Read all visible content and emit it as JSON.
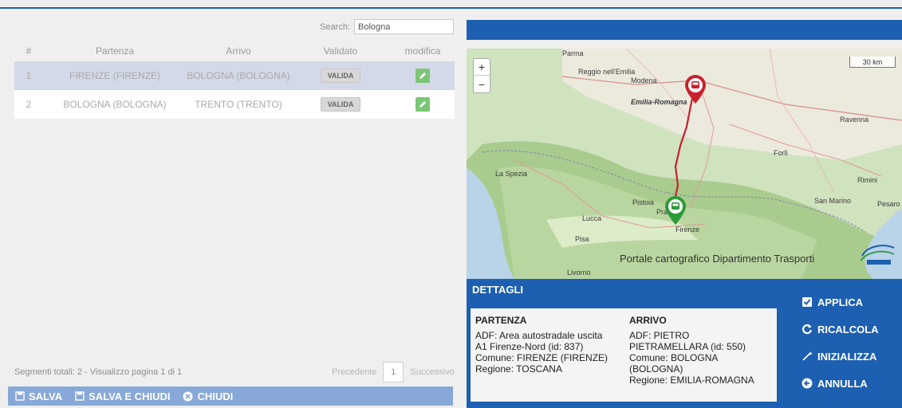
{
  "search": {
    "label": "Search:",
    "value": "Bologna"
  },
  "table": {
    "headers": [
      "#",
      "Partenza",
      "Arrivo",
      "Validato",
      "modifica"
    ],
    "rows": [
      {
        "num": "1",
        "partenza": "FIRENZE (FIRENZE)",
        "arrivo": "BOLOGNA (BOLOGNA)",
        "validato": "VALIDA"
      },
      {
        "num": "2",
        "partenza": "BOLOGNA (BOLOGNA)",
        "arrivo": "TRENTO (TRENTO)",
        "validato": "VALIDA"
      }
    ]
  },
  "footer": {
    "info": "Segmenti totali: 2 - Visualizzo pagina 1 di 1",
    "prev": "Precedente",
    "page": "1",
    "next": "Successivo"
  },
  "bottombar": {
    "salva": "SALVA",
    "salva_chiudi": "SALVA E CHIUDI",
    "chiudi": "CHIUDI"
  },
  "map": {
    "zoom_in": "+",
    "zoom_out": "−",
    "scale": "30 km",
    "credit": "Portale cartografico Dipartimento Trasporti",
    "places": [
      "Parma",
      "Reggio nell'Emilia",
      "Modena",
      "Emilia-Romagna",
      "Ravenna",
      "Forlì",
      "La Spezia",
      "Rimini",
      "San Marino",
      "Pesaro",
      "Pistoia",
      "Prato",
      "Lucca",
      "Firenze",
      "Pisa",
      "Livorno"
    ]
  },
  "details": {
    "title": "DETTAGLI",
    "partenza": {
      "heading": "PARTENZA",
      "lines": [
        "ADF: Area autostradale uscita",
        "A1 Firenze-Nord (id: 837)",
        "Comune: FIRENZE (FIRENZE)",
        "Regione: TOSCANA"
      ]
    },
    "arrivo": {
      "heading": "ARRIVO",
      "lines": [
        "ADF: PIETRO",
        "PIETRAMELLARA (id: 550)",
        "Comune: BOLOGNA",
        "(BOLOGNA)",
        "Regione: EMILIA-ROMAGNA"
      ]
    }
  },
  "actions": {
    "applica": "APPLICA",
    "ricalcola": "RICALCOLA",
    "inizializza": "INIZIALIZZA",
    "annulla": "ANNULLA"
  },
  "colors": {
    "header_blue": "#1d5fb0",
    "bottombar": "#88a9d8",
    "selected_row": "#d3d9e8",
    "edit_green": "#7cc576",
    "start_marker": "#2f9a3a",
    "end_marker": "#c8202d",
    "route": "#c8202d"
  }
}
